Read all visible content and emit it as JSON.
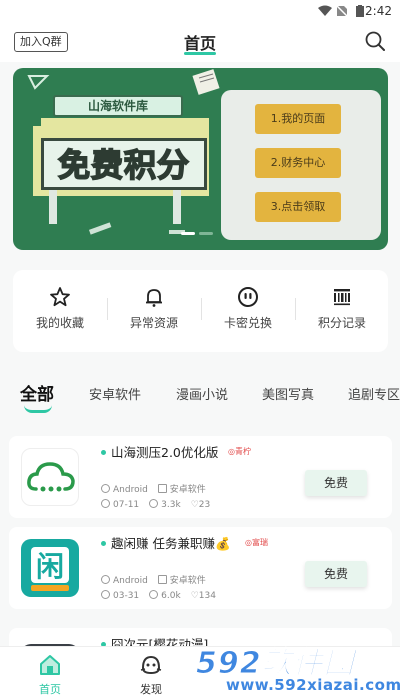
{
  "status_bar": {
    "time": "2:42"
  },
  "header": {
    "join_button": "加入Q群",
    "title": "首页"
  },
  "banner": {
    "sign_text": "山海软件库",
    "big_text": "免费积分",
    "steps": [
      "1.我的页面",
      "2.财务中心",
      "3.点击领取"
    ]
  },
  "quick_actions": [
    {
      "label": "我的收藏",
      "icon": "star-icon"
    },
    {
      "label": "异常资源",
      "icon": "bell-icon"
    },
    {
      "label": "卡密兑换",
      "icon": "face-icon"
    },
    {
      "label": "积分记录",
      "icon": "barcode-icon"
    }
  ],
  "tabs": [
    "全部",
    "安卓软件",
    "漫画小说",
    "美图写真",
    "追剧专区"
  ],
  "apps": [
    {
      "title": "山海测压2.0优化版",
      "tag": "◎青柠",
      "platform": "Android",
      "category": "安卓软件",
      "date": "07-11",
      "views": "3.3k",
      "likes": "23",
      "button": "免费"
    },
    {
      "title": "趣闲赚 任务兼职赚💰",
      "tag": "◎富瑞",
      "platform": "Android",
      "category": "安卓软件",
      "date": "03-31",
      "views": "6.0k",
      "likes": "134",
      "button": "免费"
    },
    {
      "title": "囧次元[樱花动漫]",
      "tag": "",
      "platform": "",
      "category": "",
      "date": "",
      "views": "",
      "likes": "",
      "button": ""
    }
  ],
  "bottom_nav": [
    {
      "label": "首页",
      "icon": "home-icon",
      "active": true
    },
    {
      "label": "发现",
      "icon": "discover-icon",
      "active": false
    }
  ],
  "watermark": {
    "text": "592软件园",
    "url": "www.592xiazai.com"
  },
  "colors": {
    "accent": "#2ec7a4",
    "banner_bg": "#2f7d51",
    "step_button": "#e3b43f"
  }
}
